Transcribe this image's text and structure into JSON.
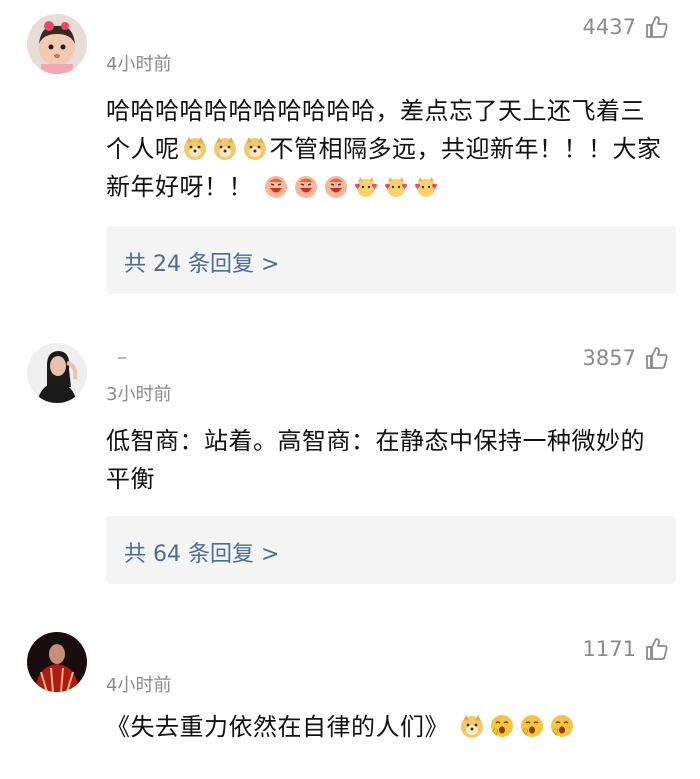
{
  "comments": [
    {
      "likes": "4437",
      "time": "4小时前",
      "text_parts": [
        "哈哈哈哈哈哈哈哈哈哈哈，差点忘了天上还飞着三个人呢",
        "不管相隔多远，共迎新年！！！大家新年好呀！！"
      ],
      "replies_label": "共 24 条回复 >",
      "avatar_icon": "baby-avatar",
      "emojis_a": [
        "doge-emoji",
        "doge-emoji",
        "doge-emoji"
      ],
      "emojis_b": [
        "happy-face-emoji",
        "happy-face-emoji",
        "happy-face-emoji",
        "cat-hearts-emoji",
        "cat-hearts-emoji",
        "cat-hearts-emoji"
      ]
    },
    {
      "likes": "3857",
      "time": "3小时前",
      "text": "低智商：站着。高智商：在静态中保持一种微妙的平衡",
      "replies_label": "共 64 条回复 >",
      "avatar_icon": "woman-avatar"
    },
    {
      "likes": "1171",
      "time": "4小时前",
      "text": "《失去重力依然在自律的人们》",
      "avatar_icon": "red-costume-avatar",
      "emojis": [
        "doge-emoji",
        "yawn-emoji",
        "yawn-emoji",
        "yawn-emoji"
      ]
    }
  ],
  "colors": {
    "meta": "#8a8a8a",
    "link": "#4a6c95",
    "reply_bg": "#f4f4f4"
  },
  "icons": {
    "like": "thumbs-up-outline-icon"
  }
}
